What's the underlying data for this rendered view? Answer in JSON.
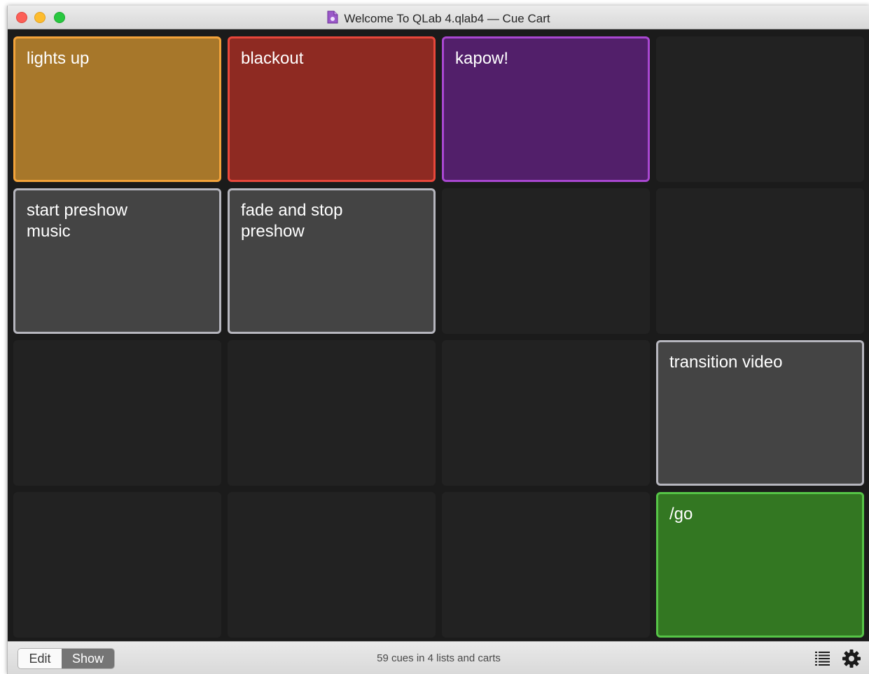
{
  "window": {
    "title": "Welcome To QLab 4.qlab4 — Cue Cart"
  },
  "cart": {
    "cells": [
      {
        "label": "lights up",
        "fill": "#a7772a",
        "border": "#f3a33a"
      },
      {
        "label": "blackout",
        "fill": "#8e2a22",
        "border": "#e8473b"
      },
      {
        "label": "kapow!",
        "fill": "#521f6a",
        "border": "#a947d1"
      },
      {
        "label": "",
        "fill": "",
        "border": ""
      },
      {
        "label": "start preshow\nmusic",
        "fill": "#444444",
        "border": "#b6b6be"
      },
      {
        "label": "fade and stop\npreshow",
        "fill": "#444444",
        "border": "#b6b6be"
      },
      {
        "label": "",
        "fill": "",
        "border": ""
      },
      {
        "label": "",
        "fill": "",
        "border": ""
      },
      {
        "label": "",
        "fill": "",
        "border": ""
      },
      {
        "label": "",
        "fill": "",
        "border": ""
      },
      {
        "label": "",
        "fill": "",
        "border": ""
      },
      {
        "label": "transition video",
        "fill": "#444444",
        "border": "#b6b6be"
      },
      {
        "label": "",
        "fill": "",
        "border": ""
      },
      {
        "label": "",
        "fill": "",
        "border": ""
      },
      {
        "label": "",
        "fill": "",
        "border": ""
      },
      {
        "label": "/go",
        "fill": "#337722",
        "border": "#56c447"
      }
    ]
  },
  "footer": {
    "edit_label": "Edit",
    "show_label": "Show",
    "status": "59 cues in 4 lists and carts",
    "list_icon": "list-icon",
    "settings_icon": "gear-icon"
  }
}
